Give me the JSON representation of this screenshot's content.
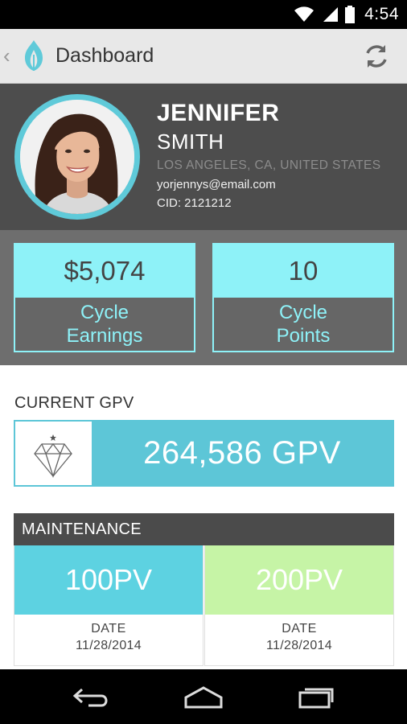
{
  "status_bar": {
    "time": "4:54",
    "icons": [
      "wifi-icon",
      "cell-signal-icon",
      "battery-icon"
    ]
  },
  "action_bar": {
    "title": "Dashboard",
    "icons": [
      "back-chevron-icon",
      "app-logo-icon",
      "refresh-icon"
    ]
  },
  "profile": {
    "first_name": "JENNIFER",
    "last_name": "SMITH",
    "location": "LOS ANGELES, CA, UNITED STATES",
    "email": "yorjennys@email.com",
    "cid": "CID: 2121212"
  },
  "stats": {
    "earnings_value": "$5,074",
    "earnings_label_line1": "Cycle",
    "earnings_label_line2": "Earnings",
    "points_value": "10",
    "points_label_line1": "Cycle",
    "points_label_line2": "Points"
  },
  "gpv": {
    "heading": "CURRENT GPV",
    "value": "264,586 GPV",
    "icon": "diamond-icon"
  },
  "maintenance": {
    "heading": "MAINTENANCE",
    "columns": [
      {
        "value": "100PV",
        "date_label": "DATE",
        "date": "11/28/2014"
      },
      {
        "value": "200PV",
        "date_label": "DATE",
        "date": "11/28/2014"
      }
    ]
  },
  "nav_bar": {
    "icons": [
      "nav-back-icon",
      "nav-home-icon",
      "nav-recents-icon"
    ]
  },
  "colors": {
    "accent_cyan": "#8ef2f8",
    "gpv_teal": "#5dc6d7",
    "maint_blue": "#5dd2e1",
    "maint_green": "#c6f4a6",
    "profile_bg": "#4d4d4d",
    "stats_bg": "#6e6e6e"
  }
}
